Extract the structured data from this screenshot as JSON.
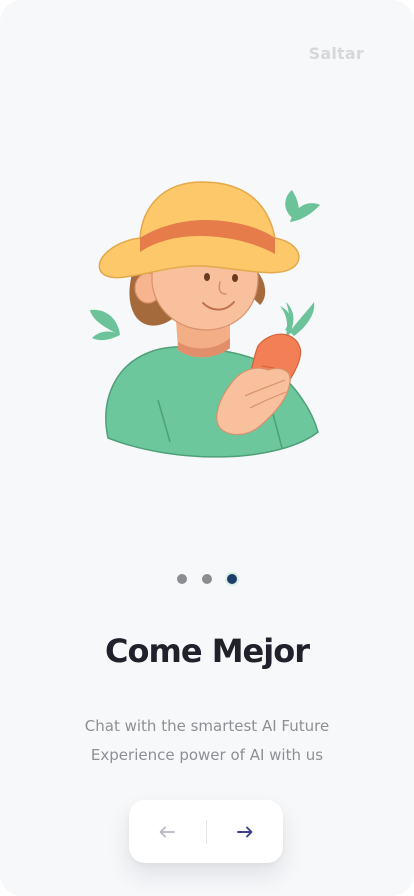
{
  "header": {
    "skip_label": "Saltar"
  },
  "illustration": {
    "subject": "farmer-boy-holding-carrot"
  },
  "pagination": {
    "total": 3,
    "current": 3
  },
  "content": {
    "title": "Come Mejor",
    "description_line1": "Chat with the smartest AI Future",
    "description_line2": "Experience power of AI with us"
  },
  "navigation": {
    "prev_icon": "arrow-left-icon",
    "next_icon": "arrow-right-icon"
  },
  "colors": {
    "background": "#f7f8fa",
    "title": "#20212b",
    "description": "#8e8f94",
    "skip": "#d7d8dc",
    "dot_inactive": "#8c8d91",
    "dot_active": "#1d3d6b",
    "next_arrow": "#3a3f8f",
    "prev_arrow": "#b7b8c4"
  }
}
